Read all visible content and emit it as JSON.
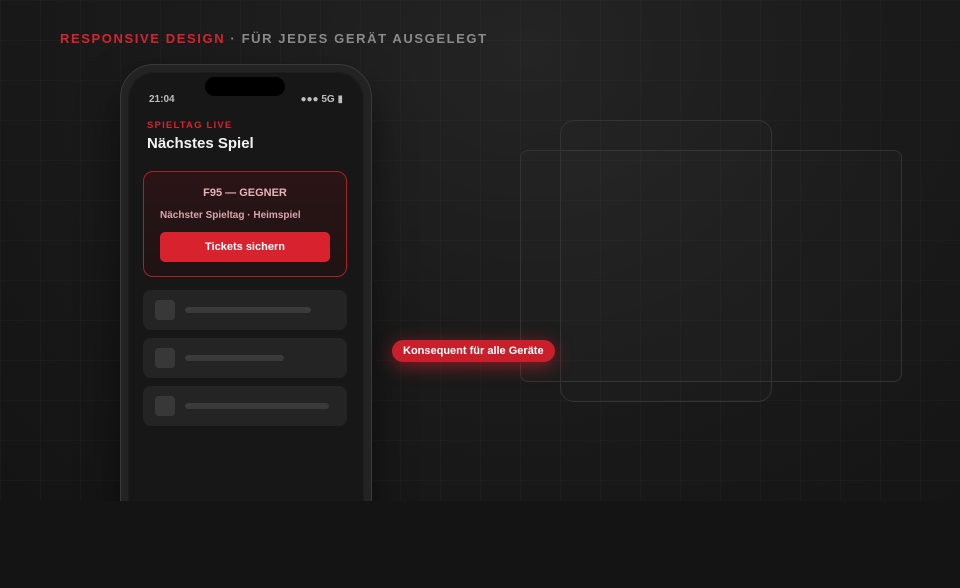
{
  "header": {
    "accent": "RESPONSIVE DESIGN",
    "separator": "·",
    "rest": "FÜR JEDES GERÄT AUSGELEGT"
  },
  "phone": {
    "status_time": "21:04",
    "status_right": "●●● 5G ▮",
    "eyebrow": "SPIELTAG LIVE",
    "title": "Nächstes Spiel",
    "match": {
      "title": "F95 — GEGNER",
      "subtitle": "Nächster Spieltag · Heimspiel",
      "cta_label": "Tickets sichern"
    }
  },
  "badge": {
    "label": "Konsequent für alle Geräte"
  },
  "colors": {
    "accent": "#d8232f",
    "background": "#1b1b1b",
    "muted_text": "#8a8a8a"
  }
}
